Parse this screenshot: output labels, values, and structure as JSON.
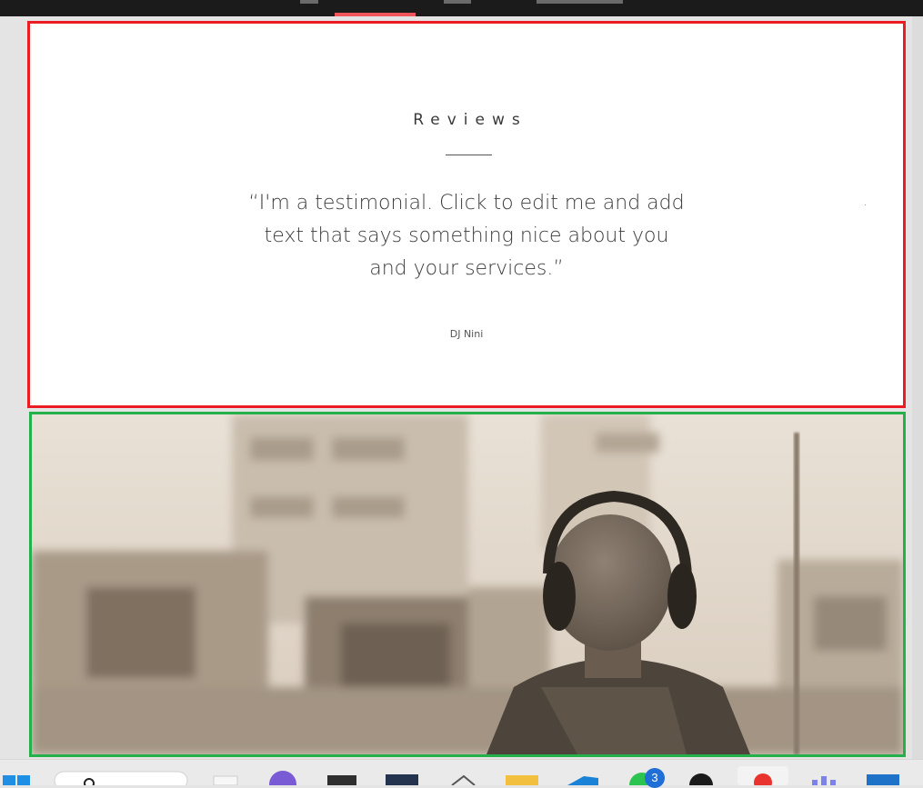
{
  "reviews": {
    "title": "Reviews",
    "quote": "“I'm a testimonial. Click to edit me and add text that says something nice about you and your services.”",
    "author": "DJ Nini"
  },
  "hero": {
    "image_description_icon": "person-with-headphones-city-photo"
  },
  "taskbar": {
    "icons": [
      "windows-start-icon",
      "search-icon",
      "file-icon",
      "copilot-icon",
      "app-icon",
      "media-icon",
      "mail-icon",
      "folder-icon",
      "vscode-icon",
      "whatsapp-icon",
      "github-icon",
      "app-icon",
      "teams-icon",
      "browser-icon"
    ],
    "whatsapp_badge": "3"
  },
  "colors": {
    "reviews_border": "#ea1c24",
    "hero_border": "#24b04b",
    "active_tab": "#f0555c"
  }
}
